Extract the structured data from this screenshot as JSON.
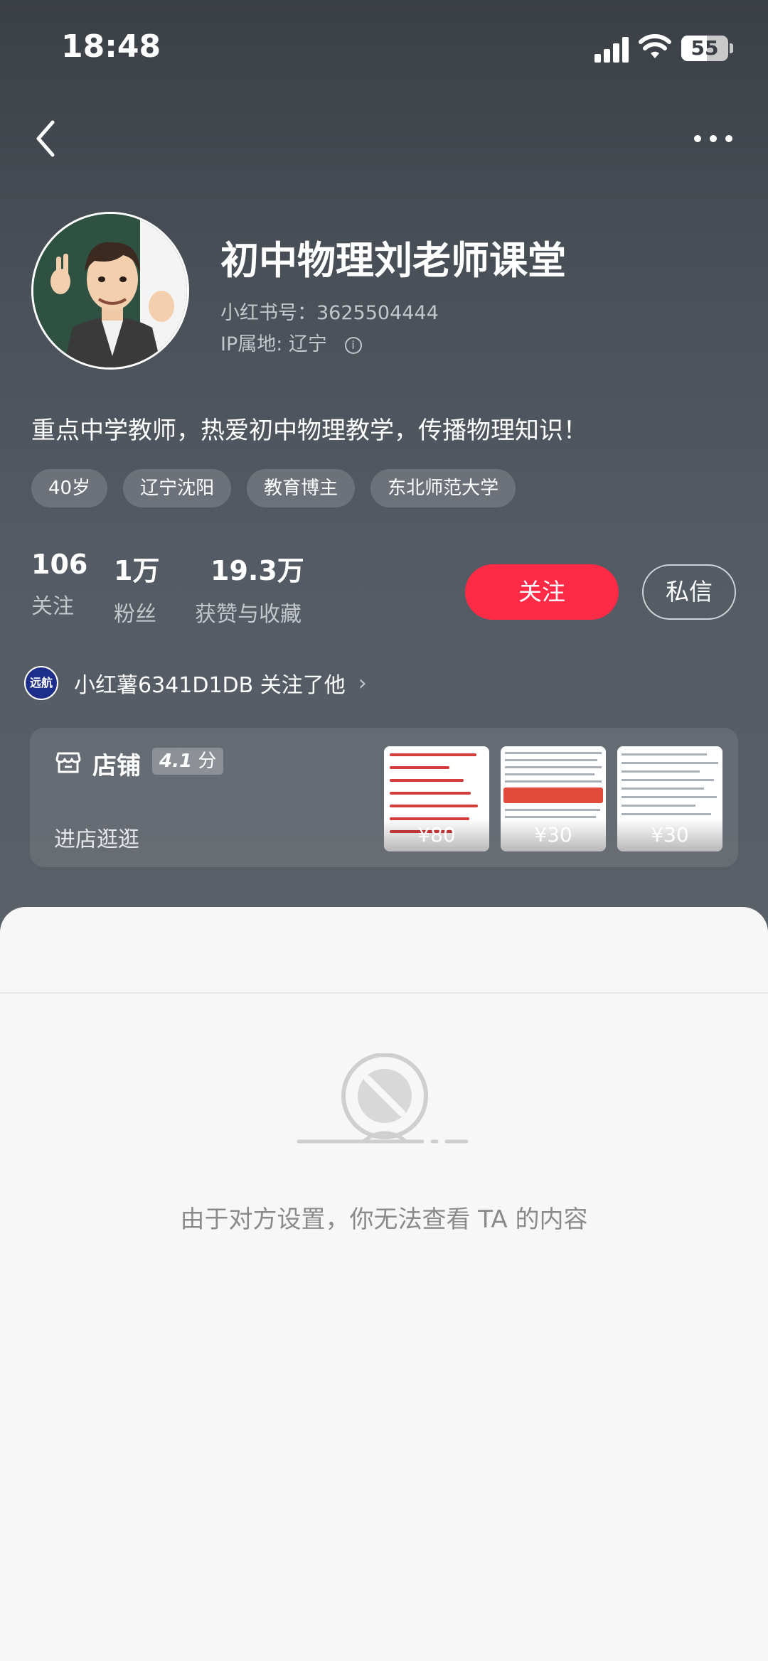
{
  "status_bar": {
    "time": "18:48",
    "battery": "55",
    "battery_level": 0.55
  },
  "profile": {
    "name": "初中物理刘老师课堂",
    "rednote_id": "小红书号：3625504444",
    "ip_location": "IP属地: 辽宁",
    "bio": "重点中学教师，热爱初中物理教学，传播物理知识！",
    "tags": [
      "40岁",
      "辽宁沈阳",
      "教育博主",
      "东北师范大学"
    ]
  },
  "stats": {
    "following": {
      "value": "106",
      "label": "关注"
    },
    "followers": {
      "value": "1万",
      "label": "粉丝"
    },
    "likes": {
      "value": "19.3万",
      "label": "获赞与收藏"
    }
  },
  "actions": {
    "follow_label": "关注",
    "message_label": "私信"
  },
  "mutual": {
    "avatar_text": "远航",
    "text": "小红薯6341D1DB 关注了他"
  },
  "shop": {
    "label": "店铺",
    "rating": "4.1",
    "rating_unit": "分",
    "enter_label": "进店逛逛",
    "products": [
      {
        "price": "¥80"
      },
      {
        "price": "¥30"
      },
      {
        "price": "¥30"
      }
    ]
  },
  "empty_state": {
    "message": "由于对方设置，你无法查看 TA 的内容"
  },
  "colors": {
    "accent": "#ff2a45",
    "header_dark": "#3b4046",
    "sheet": "#f7f7f7"
  }
}
